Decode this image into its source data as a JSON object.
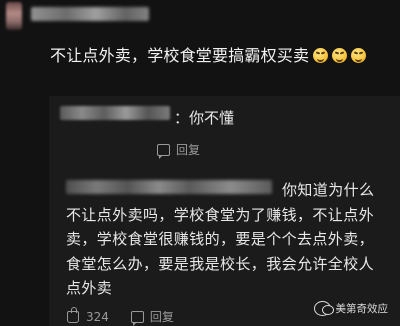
{
  "main_comment": {
    "text": "不让点外卖，学校食堂要搞霸权买卖",
    "emojis": [
      "grin-sweat-emoji",
      "grin-sweat-emoji",
      "grin-sweat-emoji"
    ]
  },
  "replies": [
    {
      "text": "：你不懂",
      "action_label": "回复"
    },
    {
      "text": "你知道为什么不让点外卖吗，学校食堂为了赚钱，不让点外卖，学校食堂很赚钱的，要是个个去点外卖，食堂怎么办，要是我是校长，我会允许全校人点外卖",
      "like_count": "324",
      "action_label": "回复"
    }
  ],
  "watermark": {
    "text": "美第奇效应"
  }
}
